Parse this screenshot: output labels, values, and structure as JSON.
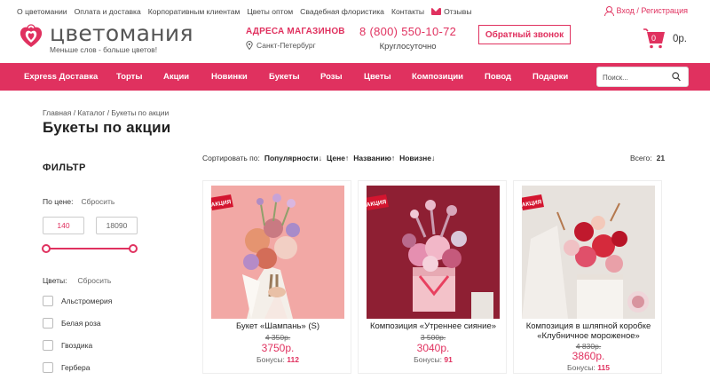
{
  "topbar": {
    "links": [
      "О цветомании",
      "Оплата и доставка",
      "Корпоративным клиентам",
      "Цветы оптом",
      "Свадебная флористика",
      "Контакты"
    ],
    "reviews": "Отзывы",
    "login": "Вход / Регистрация"
  },
  "header": {
    "logo_name": "цветомания",
    "logo_slogan": "Меньше слов - больше цветов!",
    "stores_title": "АДРЕСА МАГАЗИНОВ",
    "city": "Санкт-Петербург",
    "phone": "8 (800) 550-10-72",
    "hours": "Круглосуточно",
    "callback": "Обратный звонок",
    "cart_count": "0",
    "cart_sum": "0р."
  },
  "nav": {
    "items": [
      "Express Доставка",
      "Торты",
      "Акции",
      "Новинки",
      "Букеты",
      "Розы",
      "Цветы",
      "Композиции",
      "Повод",
      "Подарки"
    ],
    "search_placeholder": "Поиск..."
  },
  "breadcrumb": "Главная / Каталог / Букеты по акции",
  "page_title": "Букеты по акции",
  "filter": {
    "title": "ФИЛЬТР",
    "price_label": "По цене:",
    "reset": "Сбросить",
    "price_min": "140",
    "price_max": "18090",
    "colors_label": "Цветы:",
    "colors": [
      "Альстромерия",
      "Белая роза",
      "Гвоздика",
      "Гербера"
    ]
  },
  "sort": {
    "label": "Сортировать по:",
    "options": [
      "Популярности↓",
      "Цене↑",
      "Названию↑",
      "Новизне↓"
    ],
    "total_label": "Всего:",
    "total": "21"
  },
  "sale_tag": "АКЦИЯ",
  "products": [
    {
      "name_lines": [
        "Букет «Шампань» (S)"
      ],
      "old_price": "4 350р.",
      "price": "3750р.",
      "bonus_label": "Бонусы:",
      "bonus": "112"
    },
    {
      "name_lines": [
        "Композиция «Утреннее сияние»"
      ],
      "old_price": "3 500р.",
      "price": "3040р.",
      "bonus_label": "Бонусы:",
      "bonus": "91"
    },
    {
      "name_lines": [
        "Композиция в шляпной коробке",
        "«Клубничное мороженое»"
      ],
      "old_price": "4 830р.",
      "price": "3860р.",
      "bonus_label": "Бонусы:",
      "bonus": "115"
    }
  ],
  "colors": {
    "accent": "#e0315f",
    "nav_bg": "#e0315f"
  }
}
